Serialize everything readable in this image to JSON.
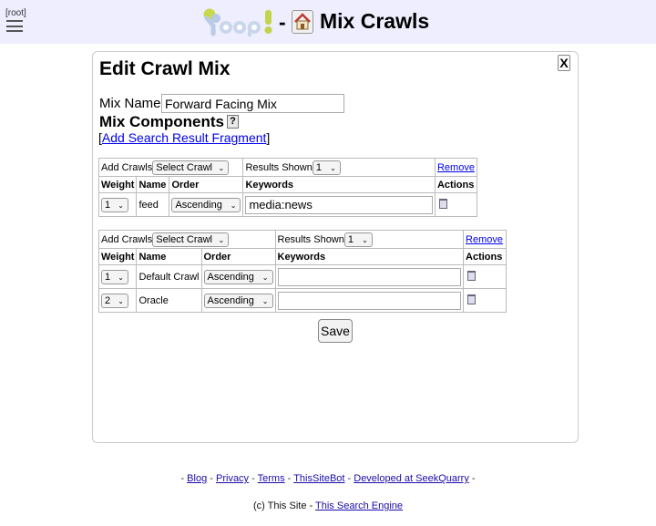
{
  "header": {
    "root_link": "[root]",
    "separator": "-",
    "title": "Mix Crawls",
    "logo_icon": "yioop-logo",
    "home_icon": "house-icon",
    "colors": {
      "bar_bg": "#eeeeff"
    }
  },
  "panel": {
    "close_label": "X",
    "title": "Edit Crawl Mix",
    "mix_name_label": "Mix Name",
    "mix_name_value": "Forward Facing Mix",
    "components_label": "Mix Components",
    "help_label": "?",
    "add_fragment_open": "[",
    "add_fragment_link": "Add Search Result Fragment",
    "add_fragment_close": "]",
    "save_label": "Save"
  },
  "fragments": [
    {
      "add_crawls_label": "Add Crawls",
      "select_crawl": "Select Crawl",
      "results_shown_label": "Results Shown",
      "results_shown_value": "1",
      "remove_label": "Remove",
      "columns": [
        "Weight",
        "Name",
        "Order",
        "Keywords",
        "Actions"
      ],
      "rows": [
        {
          "weight": "1",
          "name": "feed",
          "order": "Ascending",
          "keywords": "media:news"
        }
      ]
    },
    {
      "add_crawls_label": "Add Crawls",
      "select_crawl": "Select Crawl",
      "results_shown_label": "Results Shown",
      "results_shown_value": "1",
      "remove_label": "Remove",
      "columns": [
        "Weight",
        "Name",
        "Order",
        "Keywords",
        "Actions"
      ],
      "rows": [
        {
          "weight": "1",
          "name": "Default Crawl",
          "order": "Ascending",
          "keywords": ""
        },
        {
          "weight": "2",
          "name": "Oracle",
          "order": "Ascending",
          "keywords": ""
        }
      ]
    }
  ],
  "footer": {
    "dash": "-",
    "links": [
      "Blog",
      "Privacy",
      "Terms",
      "ThisSiteBot",
      "Developed at SeekQuarry"
    ],
    "copyright": "(c) This Site -",
    "engine_link": "This Search Engine"
  }
}
